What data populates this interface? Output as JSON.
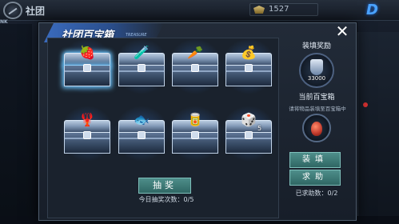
{
  "header": {
    "title": "社团",
    "left_tag": "NK",
    "currency_value": "1527",
    "logo_letter": "D"
  },
  "dialog": {
    "title": "社团百宝箱",
    "title_sub": "TREASURE",
    "close_symbol": "✕"
  },
  "chests": [
    {
      "item_icon": "🍓",
      "quantity": ""
    },
    {
      "item_icon": "🧪",
      "quantity": ""
    },
    {
      "item_icon": "🥕",
      "quantity": ""
    },
    {
      "item_icon": "💰",
      "quantity": ""
    },
    {
      "item_icon": "🦞",
      "quantity": ""
    },
    {
      "item_icon": "🐟",
      "quantity": ""
    },
    {
      "item_icon": "🥫",
      "quantity": ""
    },
    {
      "item_icon": "🎲",
      "quantity": "5"
    }
  ],
  "draw": {
    "button_label": "抽奖",
    "daily_count_label": "今日抽奖次数：0/5"
  },
  "panel": {
    "reward_title": "装填奖励",
    "reward_value": "33000",
    "current_box_label": "当前百宝箱",
    "hint": "请将物品装填至百宝箱中",
    "fill_button": "装填",
    "help_button": "求助",
    "help_count_label": "已求助数：0/2"
  },
  "colors": {
    "accent_blue": "#3a6bbd",
    "button_teal": "#2f6764"
  }
}
